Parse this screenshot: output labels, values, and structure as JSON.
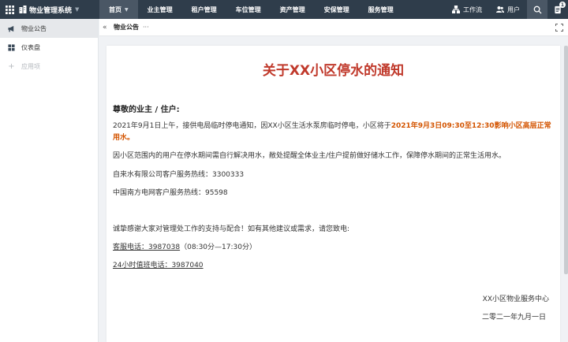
{
  "header": {
    "app_name": "物业管理系统",
    "nav": [
      {
        "label": "首页"
      },
      {
        "label": "业主管理"
      },
      {
        "label": "租户管理"
      },
      {
        "label": "车位管理"
      },
      {
        "label": "资产管理"
      },
      {
        "label": "安保管理"
      },
      {
        "label": "服务管理"
      }
    ],
    "workflow_label": "工作流",
    "user_label": "用户",
    "notification_count": "1"
  },
  "sidebar": {
    "items": [
      {
        "label": "物业公告",
        "icon": "megaphone-icon"
      },
      {
        "label": "仪表盘",
        "icon": "dashboard-icon"
      },
      {
        "label": "应用项",
        "icon": "plus-icon"
      }
    ]
  },
  "tab": {
    "collapse_glyph": "«",
    "title": "物业公告",
    "more_glyph": "···"
  },
  "notice": {
    "title": "关于XX小区停水的通知",
    "greeting": "尊敬的业主 / 住户:",
    "p1_before": "2021年9月1日上午，接供电局临时停电通知，因XX小区生活水泵房临时停电，小区将于",
    "p1_highlight": "2021年9月3日09:30至12:30影响小区高层正常用水。",
    "p2": "因小区范围内的用户在停水期间需自行解决用水，敝处提醒全体业主/住户提前做好储水工作，保障停水期间的正常生活用水。",
    "p3": "自来水有限公司客户服务热线：3300333",
    "p4": "中国南方电网客户服务热线：95598",
    "p5": "诚挚感谢大家对管理处工作的支持与配合！如有其他建议或需求，请您致电:",
    "p6_phone": "客服电话：3987038",
    "p6_hours": "（08:30分—17:30分）",
    "p7_phone": "24小时值班电话：3987040",
    "sign_org": "XX小区物业服务中心",
    "sign_date": "二零二一年九月一日"
  }
}
